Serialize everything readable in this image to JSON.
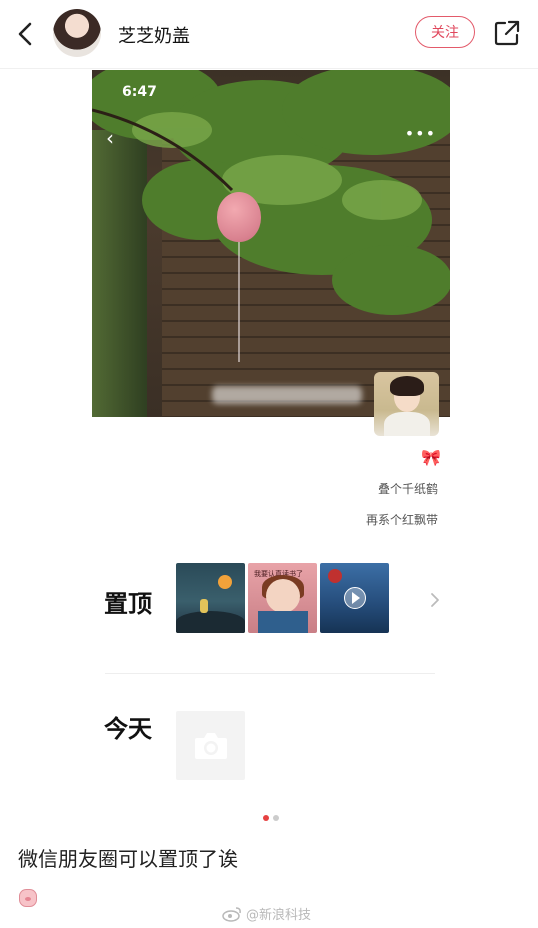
{
  "header": {
    "username": "芝芝奶盖",
    "follow_label": "关注"
  },
  "screenshot": {
    "status_time": "6:47"
  },
  "side_text": {
    "line1": "叠个千纸鹤",
    "line2": "再系个红飘带"
  },
  "pinned": {
    "label": "置顶",
    "thumb2_caption": "我要认真读书了"
  },
  "today": {
    "label": "今天"
  },
  "pager": {
    "active_index": 0,
    "count": 2
  },
  "post": {
    "caption": "微信朋友圈可以置顶了诶",
    "watermark": "@新浪科技"
  },
  "colors": {
    "accent": "#e0475c",
    "pager_active": "#e64141"
  }
}
